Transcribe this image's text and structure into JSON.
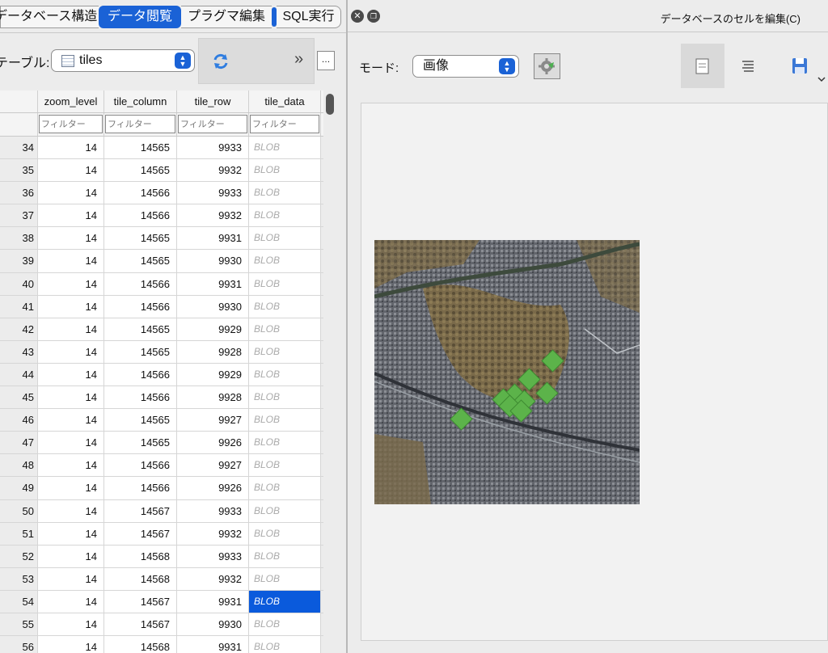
{
  "tabs": {
    "structure": "データベース構造",
    "browse": "データ閲覧",
    "pragma": "プラグマ編集",
    "sql": "SQL実行"
  },
  "table_label": "テーブル:",
  "table_select": "tiles",
  "grid": {
    "columns": [
      "zoom_level",
      "tile_column",
      "tile_row",
      "tile_data"
    ],
    "filter_placeholder": "フィルター",
    "rows": [
      {
        "id": "34",
        "zoom_level": "14",
        "tile_column": "14565",
        "tile_row": "9933",
        "tile_data": "BLOB"
      },
      {
        "id": "35",
        "zoom_level": "14",
        "tile_column": "14565",
        "tile_row": "9932",
        "tile_data": "BLOB"
      },
      {
        "id": "36",
        "zoom_level": "14",
        "tile_column": "14566",
        "tile_row": "9933",
        "tile_data": "BLOB"
      },
      {
        "id": "37",
        "zoom_level": "14",
        "tile_column": "14566",
        "tile_row": "9932",
        "tile_data": "BLOB"
      },
      {
        "id": "38",
        "zoom_level": "14",
        "tile_column": "14565",
        "tile_row": "9931",
        "tile_data": "BLOB"
      },
      {
        "id": "39",
        "zoom_level": "14",
        "tile_column": "14565",
        "tile_row": "9930",
        "tile_data": "BLOB"
      },
      {
        "id": "40",
        "zoom_level": "14",
        "tile_column": "14566",
        "tile_row": "9931",
        "tile_data": "BLOB"
      },
      {
        "id": "41",
        "zoom_level": "14",
        "tile_column": "14566",
        "tile_row": "9930",
        "tile_data": "BLOB"
      },
      {
        "id": "42",
        "zoom_level": "14",
        "tile_column": "14565",
        "tile_row": "9929",
        "tile_data": "BLOB"
      },
      {
        "id": "43",
        "zoom_level": "14",
        "tile_column": "14565",
        "tile_row": "9928",
        "tile_data": "BLOB"
      },
      {
        "id": "44",
        "zoom_level": "14",
        "tile_column": "14566",
        "tile_row": "9929",
        "tile_data": "BLOB"
      },
      {
        "id": "45",
        "zoom_level": "14",
        "tile_column": "14566",
        "tile_row": "9928",
        "tile_data": "BLOB"
      },
      {
        "id": "46",
        "zoom_level": "14",
        "tile_column": "14565",
        "tile_row": "9927",
        "tile_data": "BLOB"
      },
      {
        "id": "47",
        "zoom_level": "14",
        "tile_column": "14565",
        "tile_row": "9926",
        "tile_data": "BLOB"
      },
      {
        "id": "48",
        "zoom_level": "14",
        "tile_column": "14566",
        "tile_row": "9927",
        "tile_data": "BLOB"
      },
      {
        "id": "49",
        "zoom_level": "14",
        "tile_column": "14566",
        "tile_row": "9926",
        "tile_data": "BLOB"
      },
      {
        "id": "50",
        "zoom_level": "14",
        "tile_column": "14567",
        "tile_row": "9933",
        "tile_data": "BLOB"
      },
      {
        "id": "51",
        "zoom_level": "14",
        "tile_column": "14567",
        "tile_row": "9932",
        "tile_data": "BLOB"
      },
      {
        "id": "52",
        "zoom_level": "14",
        "tile_column": "14568",
        "tile_row": "9933",
        "tile_data": "BLOB"
      },
      {
        "id": "53",
        "zoom_level": "14",
        "tile_column": "14568",
        "tile_row": "9932",
        "tile_data": "BLOB"
      },
      {
        "id": "54",
        "zoom_level": "14",
        "tile_column": "14567",
        "tile_row": "9931",
        "tile_data": "BLOB",
        "selected": true
      },
      {
        "id": "55",
        "zoom_level": "14",
        "tile_column": "14567",
        "tile_row": "9930",
        "tile_data": "BLOB"
      },
      {
        "id": "56",
        "zoom_level": "14",
        "tile_column": "14568",
        "tile_row": "9931",
        "tile_data": "BLOB"
      }
    ]
  },
  "editor": {
    "title": "データベースのセルを編集(C)",
    "mode_label": "モード:",
    "mode_value": "画像"
  },
  "colors": {
    "accent": "#1a62d6",
    "selection": "#0a5adc",
    "marker": "#5cb34a"
  },
  "icons": [
    "table-icon",
    "refresh-icon",
    "chevrons-right-icon",
    "close-icon",
    "restore-icon",
    "gear-icon",
    "document-icon",
    "text-lines-icon",
    "save-icon"
  ]
}
